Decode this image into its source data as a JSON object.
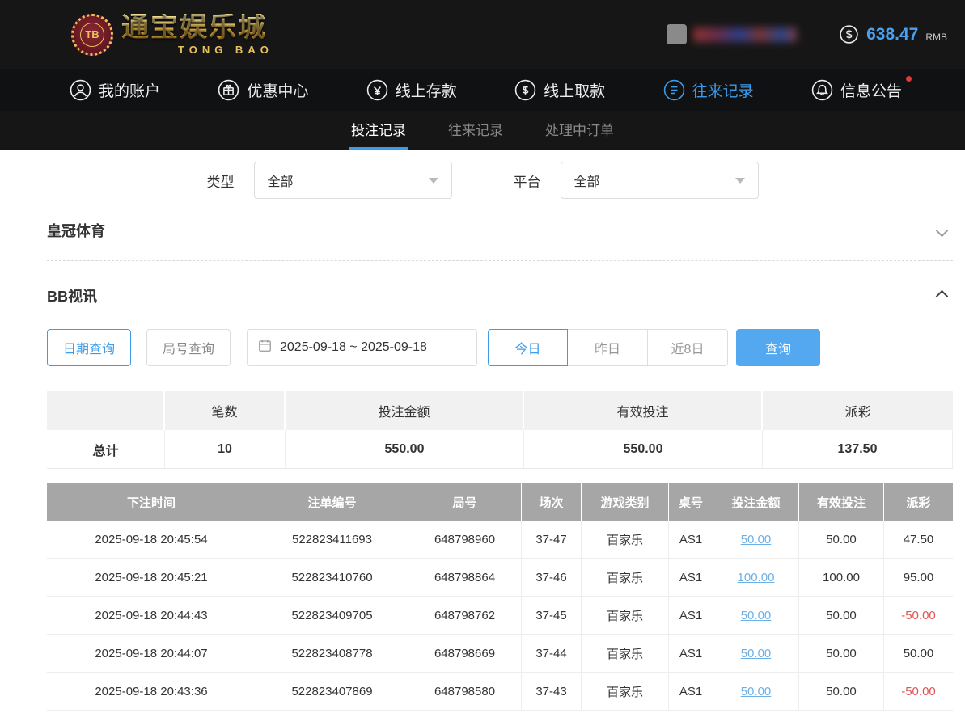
{
  "colors": {
    "accent": "#3d9be9",
    "link": "#6cb0e8",
    "negative": "#e25454",
    "gold": "#e9c05e"
  },
  "header": {
    "logo": {
      "chip": "TB",
      "title": "通宝娱乐城",
      "subtitle": "TONG BAO"
    },
    "balance": {
      "amount": "638.47",
      "currency": "RMB"
    }
  },
  "nav": {
    "items": [
      {
        "label": "我的账户",
        "icon": "user-icon"
      },
      {
        "label": "优惠中心",
        "icon": "gift-icon"
      },
      {
        "label": "线上存款",
        "icon": "deposit-icon"
      },
      {
        "label": "线上取款",
        "icon": "withdraw-icon"
      },
      {
        "label": "往来记录",
        "icon": "records-icon",
        "active": true
      },
      {
        "label": "信息公告",
        "icon": "announcement-icon",
        "badge": true
      }
    ]
  },
  "subnav": {
    "tabs": [
      {
        "label": "投注记录",
        "active": true
      },
      {
        "label": "往来记录",
        "active": false
      },
      {
        "label": "处理中订单",
        "active": false
      }
    ]
  },
  "filters": {
    "type_label": "类型",
    "type_value": "全部",
    "platform_label": "平台",
    "platform_value": "全部"
  },
  "sections": [
    {
      "title": "皇冠体育",
      "collapsed": true
    },
    {
      "title": "BB视讯",
      "collapsed": false
    }
  ],
  "query_bar": {
    "date_query": "日期查询",
    "round_query": "局号查询",
    "date_range": "2025-09-18 ~ 2025-09-18",
    "today": "今日",
    "yesterday": "昨日",
    "last8days": "近8日",
    "search": "查询"
  },
  "summary": {
    "headers": [
      "",
      "笔数",
      "投注金额",
      "有效投注",
      "派彩"
    ],
    "total_label": "总计",
    "count": "10",
    "bet_amount": "550.00",
    "valid_bet": "550.00",
    "payout": "137.50"
  },
  "table": {
    "headers": [
      "下注时间",
      "注单编号",
      "局号",
      "场次",
      "游戏类别",
      "桌号",
      "投注金额",
      "有效投注",
      "派彩"
    ],
    "rows": [
      {
        "time": "2025-09-18 20:45:54",
        "bet_id": "522823411693",
        "round": "648798960",
        "session": "37-47",
        "game": "百家乐",
        "table_no": "AS1",
        "bet": "50.00",
        "valid": "50.00",
        "payout": "47.50"
      },
      {
        "time": "2025-09-18 20:45:21",
        "bet_id": "522823410760",
        "round": "648798864",
        "session": "37-46",
        "game": "百家乐",
        "table_no": "AS1",
        "bet": "100.00",
        "valid": "100.00",
        "payout": "95.00"
      },
      {
        "time": "2025-09-18 20:44:43",
        "bet_id": "522823409705",
        "round": "648798762",
        "session": "37-45",
        "game": "百家乐",
        "table_no": "AS1",
        "bet": "50.00",
        "valid": "50.00",
        "payout": "-50.00"
      },
      {
        "time": "2025-09-18 20:44:07",
        "bet_id": "522823408778",
        "round": "648798669",
        "session": "37-44",
        "game": "百家乐",
        "table_no": "AS1",
        "bet": "50.00",
        "valid": "50.00",
        "payout": "50.00"
      },
      {
        "time": "2025-09-18 20:43:36",
        "bet_id": "522823407869",
        "round": "648798580",
        "session": "37-43",
        "game": "百家乐",
        "table_no": "AS1",
        "bet": "50.00",
        "valid": "50.00",
        "payout": "-50.00"
      }
    ]
  }
}
